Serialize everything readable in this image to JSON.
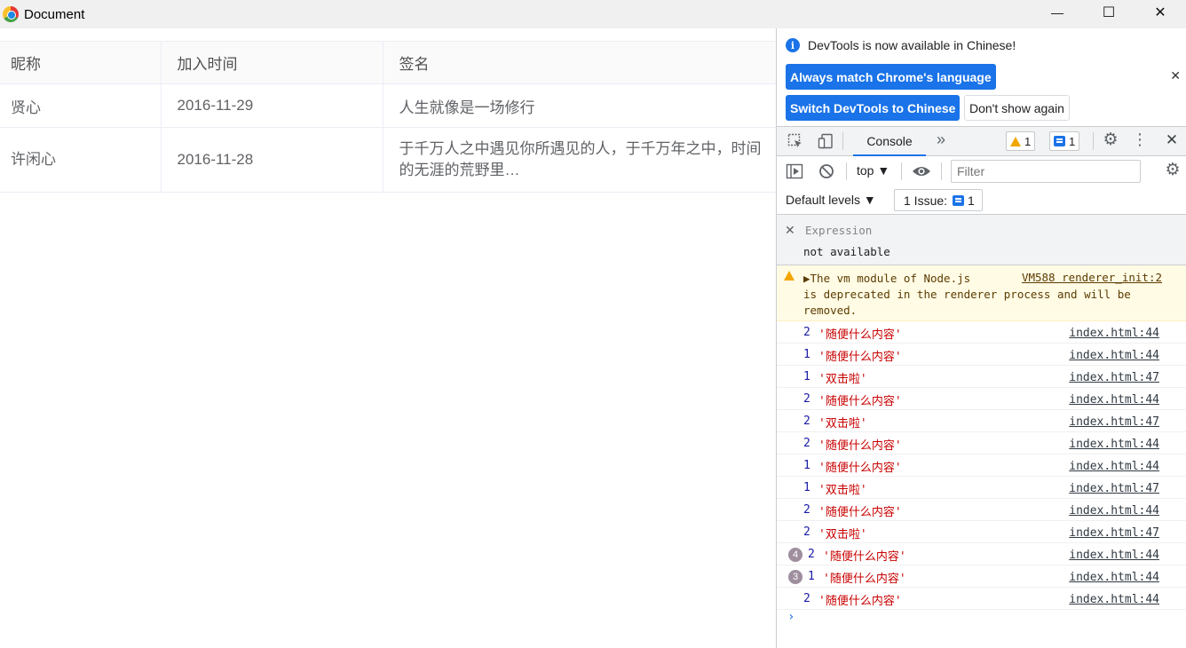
{
  "window": {
    "title": "Document",
    "minimize": "—",
    "maximize": "☐",
    "close": "✕"
  },
  "table": {
    "headers": [
      "昵称",
      "加入时间",
      "签名"
    ],
    "rows": [
      [
        "贤心",
        "2016-11-29",
        "人生就像是一场修行"
      ],
      [
        "许闲心",
        "2016-11-28",
        "于千万人之中遇见你所遇见的人，于千万年之中，时间的无涯的荒野里…"
      ]
    ]
  },
  "devtools": {
    "infobar": {
      "icon": "i",
      "message": "DevTools is now available in Chinese!",
      "always_match": "Always match Chrome's language",
      "switch_button": "Switch DevTools to Chinese",
      "dont_show": "Don't show again",
      "close": "✕"
    },
    "toolbar": {
      "console_tab": "Console",
      "more_tabs": "»",
      "warning_count": "1",
      "message_count": "1",
      "gear": "⚙",
      "kebab": "⋮",
      "close": "✕"
    },
    "filterbar": {
      "context": "top ▼",
      "filter_placeholder": "Filter"
    },
    "levels": {
      "label": "Default levels ▼",
      "issues_label": "1 Issue:",
      "issues_count": "1"
    },
    "expression": {
      "close": "✕",
      "label": "Expression",
      "value": "not available"
    },
    "warning": {
      "text": "▶The vm module of Node.js\nis deprecated in the renderer process and will be\nremoved.",
      "source": "VM588 renderer_init:2"
    },
    "logs": [
      {
        "repeat": "",
        "num": "2",
        "text": "'随便什么内容'",
        "src": "index.html:44"
      },
      {
        "repeat": "",
        "num": "1",
        "text": "'随便什么内容'",
        "src": "index.html:44"
      },
      {
        "repeat": "",
        "num": "1",
        "text": "'双击啦'",
        "src": "index.html:47"
      },
      {
        "repeat": "",
        "num": "2",
        "text": "'随便什么内容'",
        "src": "index.html:44"
      },
      {
        "repeat": "",
        "num": "2",
        "text": "'双击啦'",
        "src": "index.html:47"
      },
      {
        "repeat": "",
        "num": "2",
        "text": "'随便什么内容'",
        "src": "index.html:44"
      },
      {
        "repeat": "",
        "num": "1",
        "text": "'随便什么内容'",
        "src": "index.html:44"
      },
      {
        "repeat": "",
        "num": "1",
        "text": "'双击啦'",
        "src": "index.html:47"
      },
      {
        "repeat": "",
        "num": "2",
        "text": "'随便什么内容'",
        "src": "index.html:44"
      },
      {
        "repeat": "",
        "num": "2",
        "text": "'双击啦'",
        "src": "index.html:47"
      },
      {
        "repeat": "4",
        "num": "2",
        "text": "'随便什么内容'",
        "src": "index.html:44"
      },
      {
        "repeat": "3",
        "num": "1",
        "text": "'随便什么内容'",
        "src": "index.html:44"
      },
      {
        "repeat": "",
        "num": "2",
        "text": "'随便什么内容'",
        "src": "index.html:44"
      }
    ],
    "prompt": "›"
  }
}
